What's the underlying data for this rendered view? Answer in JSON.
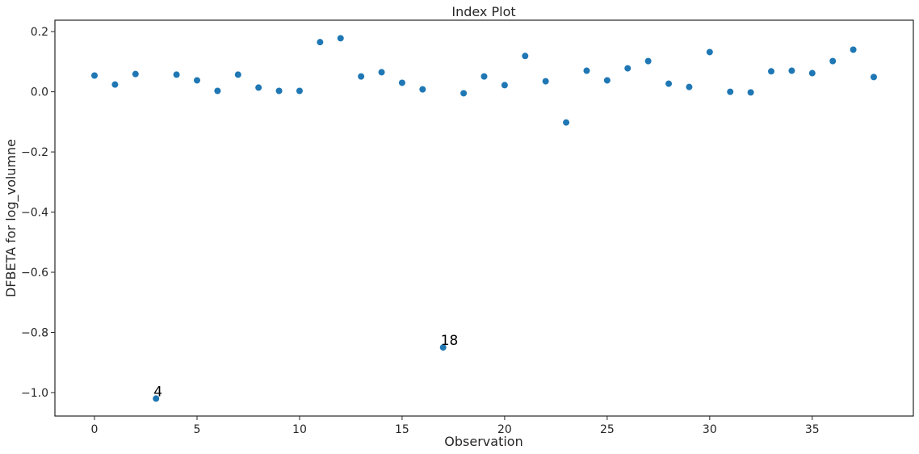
{
  "chart_data": {
    "type": "scatter",
    "title": "Index Plot",
    "xlabel": "Observation",
    "ylabel": "DFBETA for log_volumne",
    "xlim": [
      -1.93,
      39.93
    ],
    "ylim": [
      -1.078,
      0.238
    ],
    "xticks": [
      0,
      5,
      10,
      15,
      20,
      25,
      30,
      35
    ],
    "xtick_labels": [
      "0",
      "5",
      "10",
      "15",
      "20",
      "25",
      "30",
      "35"
    ],
    "yticks": [
      0.2,
      0.0,
      -0.2,
      -0.4,
      -0.6,
      -0.8,
      -1.0
    ],
    "ytick_labels": [
      "0.2",
      "0.0",
      "−0.2",
      "−0.4",
      "−0.6",
      "−0.8",
      "−1.0"
    ],
    "grid": false,
    "legend": null,
    "marker_color": "#1f77b4",
    "x": [
      0,
      1,
      2,
      3,
      4,
      5,
      6,
      7,
      8,
      9,
      10,
      11,
      12,
      13,
      14,
      15,
      16,
      17,
      18,
      19,
      20,
      21,
      22,
      23,
      24,
      25,
      26,
      27,
      28,
      29,
      30,
      31,
      32,
      33,
      34,
      35,
      36,
      37,
      38
    ],
    "y": [
      0.054,
      0.024,
      0.059,
      -1.02,
      0.057,
      0.038,
      0.003,
      0.057,
      0.014,
      0.003,
      0.003,
      0.165,
      0.178,
      0.051,
      0.065,
      0.03,
      0.008,
      -0.85,
      -0.005,
      0.051,
      0.022,
      0.119,
      0.035,
      -0.102,
      0.07,
      0.038,
      0.078,
      0.102,
      0.027,
      0.016,
      0.132,
      0.0,
      -0.002,
      0.068,
      0.07,
      0.062,
      0.102,
      0.14,
      0.049
    ],
    "annotations": [
      {
        "text": "4",
        "x": 3,
        "y": -1.02
      },
      {
        "text": "18",
        "x": 17,
        "y": -0.85
      }
    ]
  }
}
